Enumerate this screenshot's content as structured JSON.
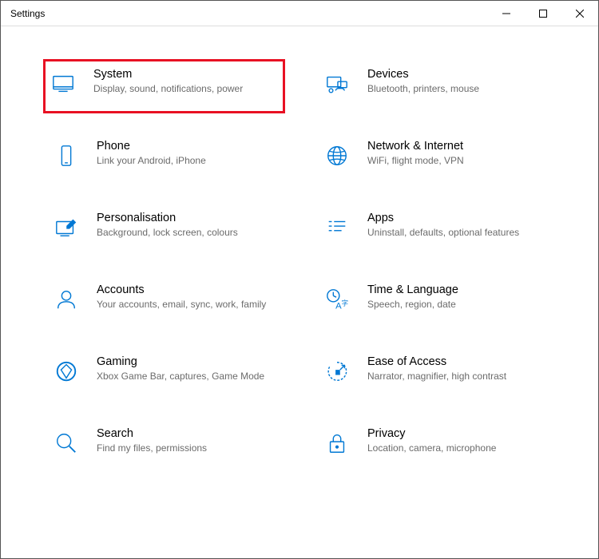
{
  "window": {
    "title": "Settings"
  },
  "categories": [
    {
      "id": "system",
      "title": "System",
      "desc": "Display, sound, notifications, power",
      "highlighted": true
    },
    {
      "id": "devices",
      "title": "Devices",
      "desc": "Bluetooth, printers, mouse",
      "highlighted": false
    },
    {
      "id": "phone",
      "title": "Phone",
      "desc": "Link your Android, iPhone",
      "highlighted": false
    },
    {
      "id": "network",
      "title": "Network & Internet",
      "desc": "WiFi, flight mode, VPN",
      "highlighted": false
    },
    {
      "id": "personalisation",
      "title": "Personalisation",
      "desc": "Background, lock screen, colours",
      "highlighted": false
    },
    {
      "id": "apps",
      "title": "Apps",
      "desc": "Uninstall, defaults, optional features",
      "highlighted": false
    },
    {
      "id": "accounts",
      "title": "Accounts",
      "desc": "Your accounts, email, sync, work, family",
      "highlighted": false
    },
    {
      "id": "time",
      "title": "Time & Language",
      "desc": "Speech, region, date",
      "highlighted": false
    },
    {
      "id": "gaming",
      "title": "Gaming",
      "desc": "Xbox Game Bar, captures, Game Mode",
      "highlighted": false
    },
    {
      "id": "ease",
      "title": "Ease of Access",
      "desc": "Narrator, magnifier, high contrast",
      "highlighted": false
    },
    {
      "id": "search",
      "title": "Search",
      "desc": "Find my files, permissions",
      "highlighted": false
    },
    {
      "id": "privacy",
      "title": "Privacy",
      "desc": "Location, camera, microphone",
      "highlighted": false
    }
  ],
  "colors": {
    "accent": "#0078d4",
    "highlight_border": "#e81123"
  }
}
